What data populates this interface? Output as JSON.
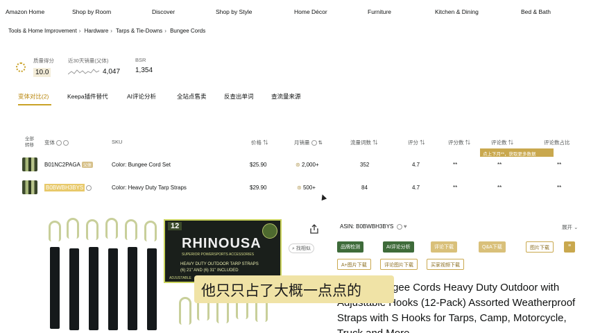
{
  "nav": {
    "items": [
      "Amazon Home",
      "Shop by Room",
      "Discover",
      "Shop by Style",
      "Home Décor",
      "Furniture",
      "Kitchen & Dining",
      "Bed & Bath"
    ]
  },
  "breadcrumb": [
    "Tools & Home Improvement",
    "Hardware",
    "Tarps & Tie-Downs",
    "Bungee Cords"
  ],
  "metrics": {
    "score": {
      "label": "质量得分",
      "value": "10.0"
    },
    "sales30": {
      "label": "近30天销量(父体)",
      "value": "4,047"
    },
    "bsr": {
      "label": "BSR",
      "value": "1,354"
    }
  },
  "tabs": [
    "变体对比(2)",
    "Keepa插件替代",
    "AI评论分析",
    "全站点售卖",
    "反查出单词",
    "查流量来源"
  ],
  "table": {
    "headers": {
      "select": "全部",
      "select2": "转移",
      "variant": "变体",
      "sku": "SKU",
      "price": "价格",
      "monthly_sales": "月销量",
      "traffic_words": "流量词数",
      "rating": "评分",
      "review_count": "评分数",
      "reviews": "评论数",
      "review_share": "评论数占比"
    },
    "tooltip": "点上下月**，获取更多数据",
    "rows": [
      {
        "asin": "B01NC2PAGA",
        "badge": "父体",
        "sku": "Color: Bungee Cord Set",
        "price": "$25.90",
        "monthly_sales": "2,000+",
        "traffic_words": "352",
        "rating": "4.7",
        "review_count": "**",
        "reviews": "**",
        "review_share": "**"
      },
      {
        "asin": "B0BWBH3BYS",
        "badge": "",
        "sku": "Color: Heavy Duty Tarp Straps",
        "price": "$29.90",
        "monthly_sales": "500+",
        "traffic_words": "84",
        "rating": "4.7",
        "review_count": "**",
        "reviews": "**",
        "review_share": "**"
      }
    ]
  },
  "product_card": {
    "count": "12",
    "brand": "RHINOUSA",
    "tagline": "SUPERIOR POWERSPORTS ACCESSORIES",
    "line1": "HEAVY DUTY OUTDOOR TARP STRAPS",
    "line2": "(6) 21\" AND (6) 31\" INCLUDED",
    "line3": "ADJUSTABLE"
  },
  "zoom_label": "找相似",
  "detail": {
    "asin_label": "ASIN:",
    "asin": "B0BWBH3BYS",
    "expand": "展开",
    "buttons": [
      {
        "label": "品牌检测",
        "style": "green"
      },
      {
        "label": "AI评论分析",
        "style": "green"
      },
      {
        "label": "评论下载",
        "style": "gold"
      },
      {
        "label": "Q&A下载",
        "style": "gold"
      },
      {
        "label": "图片下载",
        "style": "outline"
      },
      {
        "label": "A+图片下载",
        "style": "outline"
      },
      {
        "label": "评论图片下载",
        "style": "outline"
      },
      {
        "label": "买家视频下载",
        "style": "outline"
      }
    ],
    "title": "Rubber Bungee Cords Heavy Duty Outdoor with Adjustable Hooks (12-Pack) Assorted Weatherproof Straps with S Hooks for Tarps, Camp, Motorcycle, Truck and More"
  },
  "subtitle": "他只只占了大概一点点的",
  "colors": {
    "accent": "#c9a84e",
    "green": "#3e6b3a",
    "banner": "#f0e3a6"
  }
}
